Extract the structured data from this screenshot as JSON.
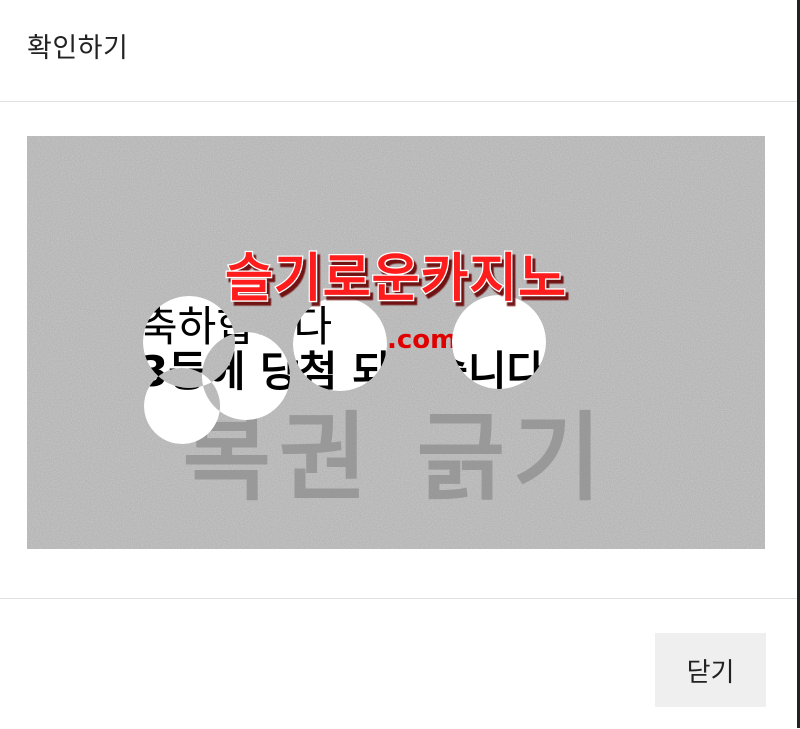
{
  "dialog": {
    "title": "확인하기",
    "close_label": "닫기"
  },
  "scratch_card": {
    "brand": "슬기로운카지노",
    "brand_domain": ".com",
    "prize_line1": "축하합니다",
    "prize_line2": "3등에 당첨 되었습니다",
    "cover_text": "복권 긁기",
    "brand_color": "#ff1a1a",
    "cover_color": "#c9c9c9"
  }
}
